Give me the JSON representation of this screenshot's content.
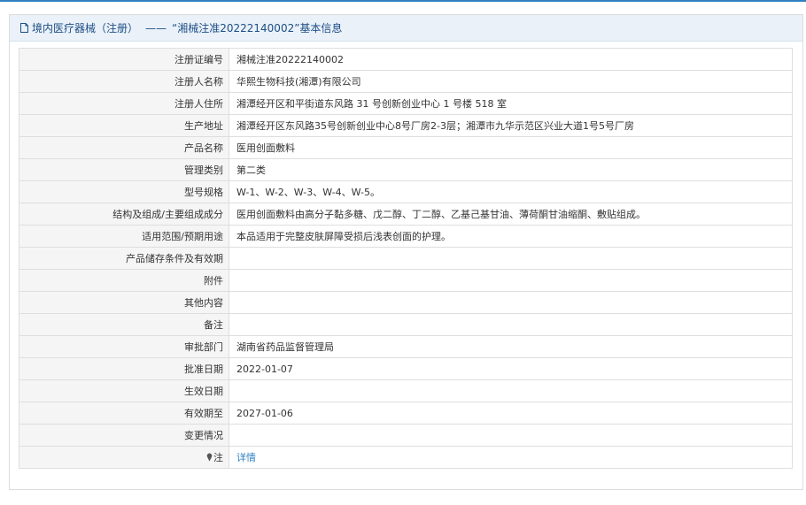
{
  "header": {
    "category": "境内医疗器械（注册）",
    "separator": "——",
    "title": "“湘械注准20222140002”基本信息"
  },
  "rows": [
    {
      "label": "注册证编号",
      "value": "湘械注准20222140002"
    },
    {
      "label": "注册人名称",
      "value": "华熙生物科技(湘潭)有限公司"
    },
    {
      "label": "注册人住所",
      "value": "湘潭经开区和平街道东风路 31 号创新创业中心 1 号楼 518 室"
    },
    {
      "label": "生产地址",
      "value": "湘潭经开区东风路35号创新创业中心8号厂房2-3层；湘潭市九华示范区兴业大道1号5号厂房"
    },
    {
      "label": "产品名称",
      "value": "医用创面敷料"
    },
    {
      "label": "管理类别",
      "value": "第二类"
    },
    {
      "label": "型号规格",
      "value": "W-1、W-2、W-3、W-4、W-5。"
    },
    {
      "label": "结构及组成/主要组成成分",
      "value": "医用创面敷料由高分子黏多糖、戊二醇、丁二醇、乙基己基甘油、薄荷酮甘油缩酮、敷贴组成。"
    },
    {
      "label": "适用范围/预期用途",
      "value": "本品适用于完整皮肤屏障受损后浅表创面的护理。"
    },
    {
      "label": "产品储存条件及有效期",
      "value": ""
    },
    {
      "label": "附件",
      "value": ""
    },
    {
      "label": "其他内容",
      "value": ""
    },
    {
      "label": "备注",
      "value": ""
    },
    {
      "label": "审批部门",
      "value": "湖南省药品监督管理局"
    },
    {
      "label": "批准日期",
      "value": "2022-01-07"
    },
    {
      "label": "生效日期",
      "value": ""
    },
    {
      "label": "有效期至",
      "value": "2027-01-06"
    },
    {
      "label": "变更情况",
      "value": ""
    }
  ],
  "note_row": {
    "label": "注",
    "icon": "pin-icon",
    "link_label": "详情"
  },
  "colors": {
    "header_text": "#1d4e86",
    "header_bg": "#eaf1f8",
    "label_bg": "#f5f5f5",
    "border": "#dedede",
    "link": "#2f7fc1"
  }
}
